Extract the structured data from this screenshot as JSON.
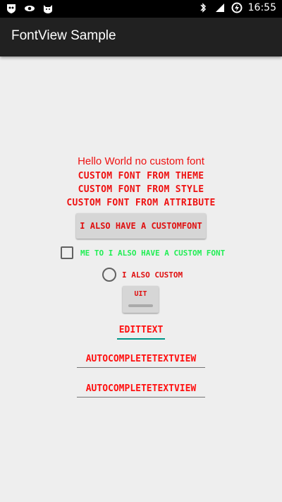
{
  "status_bar": {
    "time": "16:55",
    "icons": [
      "mask-icon",
      "eye-icon",
      "cat-icon",
      "bluetooth-icon",
      "lte-signal-icon",
      "battery-charging-icon"
    ]
  },
  "app_bar": {
    "title": "FontView Sample"
  },
  "main": {
    "hello": "Hello World no custom font",
    "theme": "Custom font from theme",
    "style": "Custom font from style",
    "attribute": "Custom font from attribute",
    "button": "I also have a customfont",
    "checkbox": "me to I also have a custom font",
    "radio": "I also custom",
    "toggle": "uit",
    "edittext": "EditText",
    "autocomplete1": "AutoCompleteTextView",
    "autocomplete2": "AutoCompleteTextView"
  },
  "colors": {
    "red": "#ee1111",
    "green": "#22ee55",
    "teal": "#009688",
    "appbar": "#212121"
  }
}
